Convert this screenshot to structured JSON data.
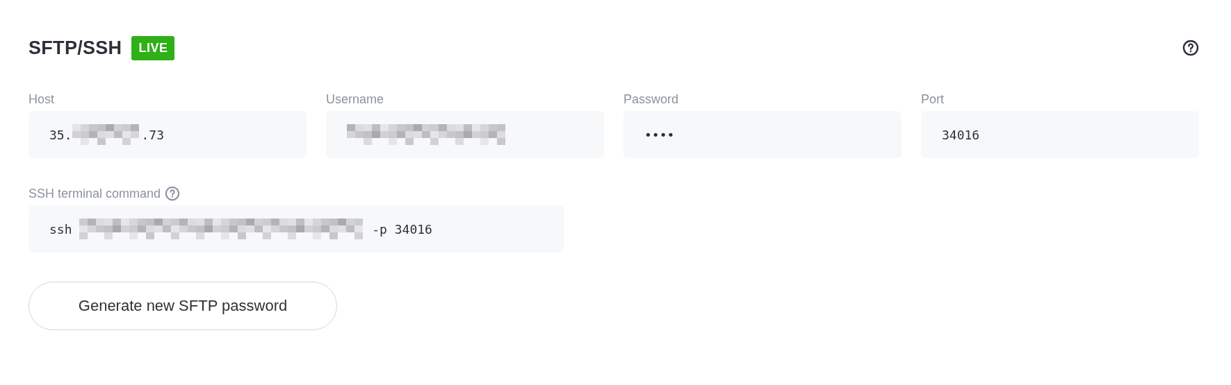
{
  "header": {
    "title": "SFTP/SSH",
    "badge": "LIVE"
  },
  "fields": [
    {
      "label": "Host",
      "segments": [
        {
          "kind": "text",
          "text": "35."
        },
        {
          "kind": "redacted"
        },
        {
          "kind": "text",
          "text": ".73"
        }
      ]
    },
    {
      "label": "Username",
      "segments": [
        {
          "kind": "redacted"
        }
      ]
    },
    {
      "label": "Password",
      "segments": [
        {
          "kind": "text",
          "text": "••••"
        }
      ]
    },
    {
      "label": "Port",
      "segments": [
        {
          "kind": "text",
          "text": "34016"
        }
      ]
    }
  ],
  "ssh_command": {
    "label": "SSH terminal command",
    "segments": [
      {
        "kind": "text",
        "text": "ssh "
      },
      {
        "kind": "redacted"
      },
      {
        "kind": "text",
        "text": " -p 34016"
      }
    ]
  },
  "button": "Generate new SFTP password"
}
